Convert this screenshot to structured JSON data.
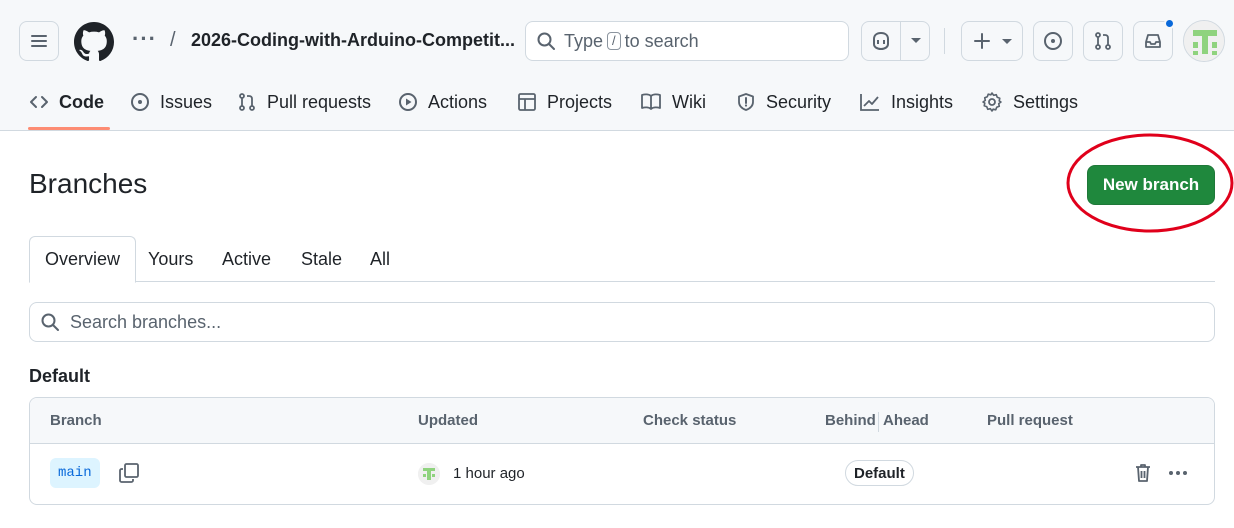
{
  "header": {
    "repo_ellipsis": "···",
    "separator": "/",
    "repo_name": "2026-Coding-with-Arduino-Competit...",
    "search": {
      "prefix": "Type",
      "key": "/",
      "suffix": "to search"
    },
    "notification_dot_color": "#0969da"
  },
  "nav": {
    "items": [
      {
        "label": "Code",
        "icon": "code-icon",
        "active": true
      },
      {
        "label": "Issues",
        "icon": "issue-opened-icon"
      },
      {
        "label": "Pull requests",
        "icon": "git-pull-request-icon"
      },
      {
        "label": "Actions",
        "icon": "play-icon"
      },
      {
        "label": "Projects",
        "icon": "table-icon"
      },
      {
        "label": "Wiki",
        "icon": "book-icon"
      },
      {
        "label": "Security",
        "icon": "shield-icon"
      },
      {
        "label": "Insights",
        "icon": "graph-icon"
      },
      {
        "label": "Settings",
        "icon": "gear-icon"
      }
    ],
    "active_underline_color": "#fd8c73"
  },
  "main": {
    "title": "Branches",
    "new_branch_label": "New branch",
    "primary_color": "#1f883d",
    "highlight_color": "#e0001b",
    "tabs": [
      "Overview",
      "Yours",
      "Active",
      "Stale",
      "All"
    ],
    "selected_tab": "Overview",
    "search_placeholder": "Search branches...",
    "section_title": "Default",
    "table": {
      "columns": [
        "Branch",
        "Updated",
        "Check status",
        "Behind",
        "Ahead",
        "Pull request"
      ],
      "rows": [
        {
          "branch": "main",
          "updated": "1 hour ago",
          "badge": "Default"
        }
      ]
    }
  }
}
